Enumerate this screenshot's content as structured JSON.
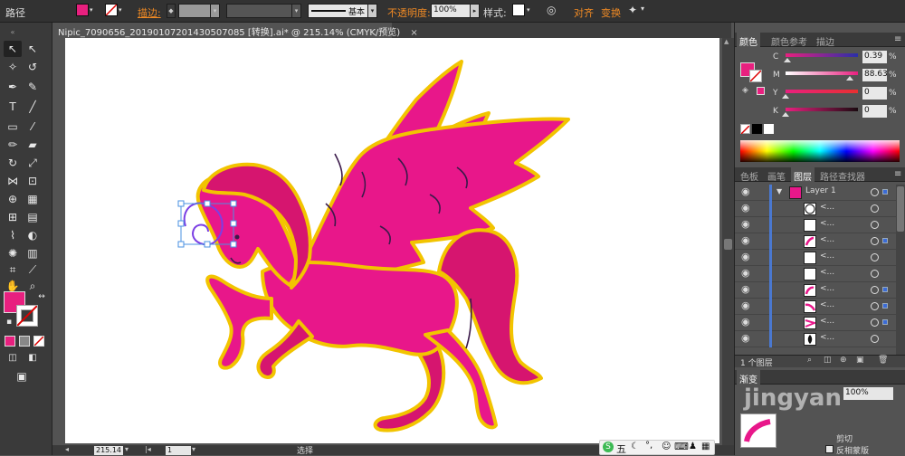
{
  "control_bar": {
    "path_label": "路径",
    "fill_color": "#e8207f",
    "stroke_label": "描边:",
    "stroke_style_label": "基本",
    "opacity_label": "不透明度:",
    "opacity_value": "100%",
    "style_label": "样式:",
    "align_label": "对齐",
    "transform_label": "变换"
  },
  "document_tab": {
    "title": "Nipic_7090656_20190107201430507085 [转换].ai* @ 215.14% (CMYK/预览)",
    "close": "×"
  },
  "tools": {
    "fill_color": "#e8207f",
    "stroke_color": "#ffffff"
  },
  "artwork": {
    "name": "pegasus",
    "body_color": "#e8178a",
    "mane_color": "#d6156f",
    "outline_color": "#f2c400",
    "ink_color": "#3b1a4a"
  },
  "status_bar": {
    "zoom": "215.14",
    "page": "1",
    "mode": "选择"
  },
  "color_panel": {
    "tabs": [
      "颜色",
      "颜色参考",
      "描边"
    ],
    "active_tab": "颜色",
    "sliders": [
      {
        "label": "C",
        "value": "0.39",
        "unit": "%"
      },
      {
        "label": "M",
        "value": "88.63",
        "unit": "%"
      },
      {
        "label": "Y",
        "value": "0",
        "unit": "%"
      },
      {
        "label": "K",
        "value": "0",
        "unit": "%"
      }
    ],
    "current_color": "#e8207f"
  },
  "layers_panel": {
    "tabs": [
      "色板",
      "画笔",
      "图层",
      "路径查找器"
    ],
    "active_tab": "图层",
    "layer_name": "Layer 1",
    "sublayer_label": "<...",
    "footer_count": "1 个图层"
  },
  "transparency_panel": {
    "tab": "渐变",
    "opacity_value": "100%",
    "clip_label": "剪切",
    "invert_mask_label": "反相蒙版"
  },
  "ime_bar": {
    "label": "五"
  },
  "watermark": {
    "text": "jingyan"
  }
}
